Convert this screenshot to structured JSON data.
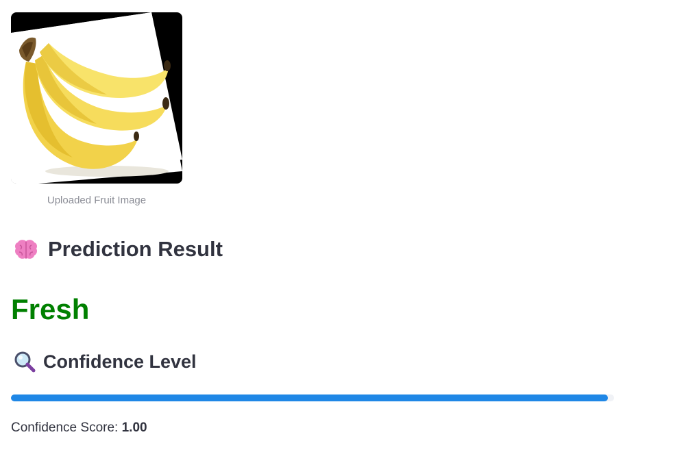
{
  "image": {
    "caption": "Uploaded Fruit Image",
    "subject": "bananas"
  },
  "prediction": {
    "heading_icon": "brain-icon",
    "heading": "Prediction Result",
    "label": "Fresh",
    "label_color": "#008000"
  },
  "confidence": {
    "heading_icon": "magnifier-icon",
    "heading": "Confidence Level",
    "progress_fraction": 0.99,
    "bar_color": "#1f87e6",
    "score_prefix": "Confidence Score: ",
    "score_value": "1.00"
  }
}
